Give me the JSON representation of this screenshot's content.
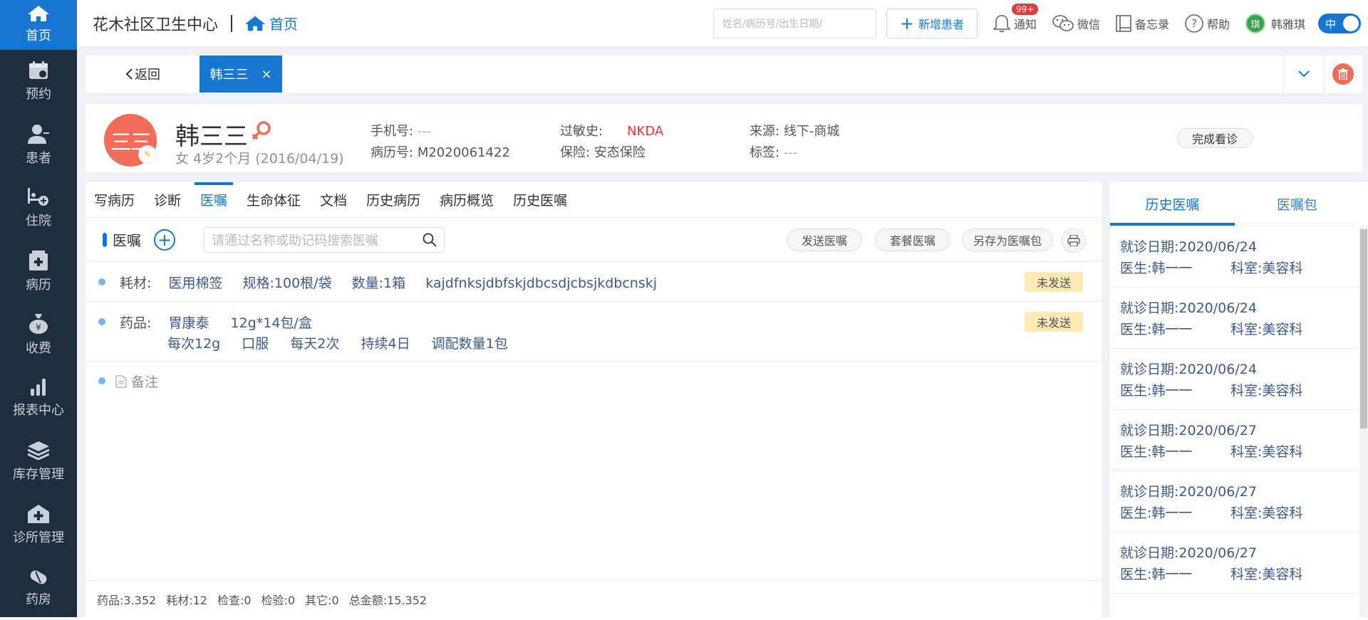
{
  "sidebar": {
    "items": [
      {
        "label": "首页",
        "icon": "home-icon"
      },
      {
        "label": "预约",
        "icon": "calendar-icon"
      },
      {
        "label": "患者",
        "icon": "user-icon"
      },
      {
        "label": "住院",
        "icon": "bed-icon"
      },
      {
        "label": "病历",
        "icon": "medical-record-icon"
      },
      {
        "label": "收费",
        "icon": "money-bag-icon"
      },
      {
        "label": "报表中心",
        "icon": "bar-chart-icon"
      },
      {
        "label": "库存管理",
        "icon": "layers-icon"
      },
      {
        "label": "诊所管理",
        "icon": "clinic-icon"
      },
      {
        "label": "药房",
        "icon": "pill-icon"
      }
    ]
  },
  "header": {
    "org_name": "花木社区卫生中心",
    "home_crumb": "首页",
    "search_placeholder": "姓名/病历号/出生日期/",
    "new_patient_label": "新增患者",
    "notify_label": "通知",
    "notify_badge": "99+",
    "wechat_label": "微信",
    "memo_label": "备忘录",
    "help_label": "帮助",
    "user_avatar_char": "琪",
    "user_name": "韩雅琪",
    "lang_toggle": "中"
  },
  "tabs": {
    "back_label": "返回",
    "patient_tab_label": "韩三三"
  },
  "patient": {
    "avatar_text": "三三",
    "name": "韩三三",
    "meta": "女  4岁2个月  (2016/04/19)",
    "phone_label": "手机号:",
    "phone_value": "---",
    "record_label": "病历号:",
    "record_value": "M2020061422",
    "allergy_label": "过敏史:",
    "allergy_value": "NKDA",
    "insurance_label": "保险:",
    "insurance_value": "安态保险",
    "source_label": "来源:",
    "source_value": "线下-商城",
    "tag_label": "标签:",
    "tag_value": "---",
    "done_button": "完成看诊"
  },
  "subtabs": [
    "写病历",
    "诊断",
    "医嘱",
    "生命体征",
    "文档",
    "历史病历",
    "病历概览",
    "历史医嘱"
  ],
  "orders": {
    "title": "医嘱",
    "search_placeholder": "请通过名称或助记码搜索医嘱",
    "send_button": "发送医嘱",
    "package_button": "套餐医嘱",
    "save_as_button": "另存为医嘱包",
    "rows": [
      {
        "category": "耗材:",
        "name": "医用棉签",
        "spec": "规格:100根/袋",
        "qty": "数量:1箱",
        "note": "kajdfnksjdbfskjdbcsdjcbsjkdbcnskj",
        "status": "未发送"
      },
      {
        "category": "药品:",
        "name": "胃康泰",
        "spec": "12g*14包/盒",
        "dose": "每次12g",
        "route": "口服",
        "freq": "每天2次",
        "duration": "持续4日",
        "dispense": "调配数量1包",
        "status": "未发送"
      }
    ],
    "remark_label": "备注"
  },
  "footer": {
    "drug": "药品:3.352",
    "material": "耗材:12",
    "exam": "检查:0",
    "test": "检验:0",
    "other": "其它:0",
    "total": "总金额:15.352"
  },
  "right_panel": {
    "tab_history": "历史医嘱",
    "tab_package": "医嘱包",
    "history": [
      {
        "date": "就诊日期:2020/06/24",
        "doctor": "医生:韩一一",
        "dept": "科室:美容科"
      },
      {
        "date": "就诊日期:2020/06/24",
        "doctor": "医生:韩一一",
        "dept": "科室:美容科"
      },
      {
        "date": "就诊日期:2020/06/24",
        "doctor": "医生:韩一一",
        "dept": "科室:美容科"
      },
      {
        "date": "就诊日期:2020/06/27",
        "doctor": "医生:韩一一",
        "dept": "科室:美容科"
      },
      {
        "date": "就诊日期:2020/06/27",
        "doctor": "医生:韩一一",
        "dept": "科室:美容科"
      },
      {
        "date": "就诊日期:2020/06/27",
        "doctor": "医生:韩一一",
        "dept": "科室:美容科"
      }
    ]
  },
  "colors": {
    "primary": "#1677d2",
    "sidebar_bg": "#1f2d3d",
    "avatar": "#f26c5a",
    "allergy": "#e5393b",
    "status_bg": "#fde9b4"
  }
}
